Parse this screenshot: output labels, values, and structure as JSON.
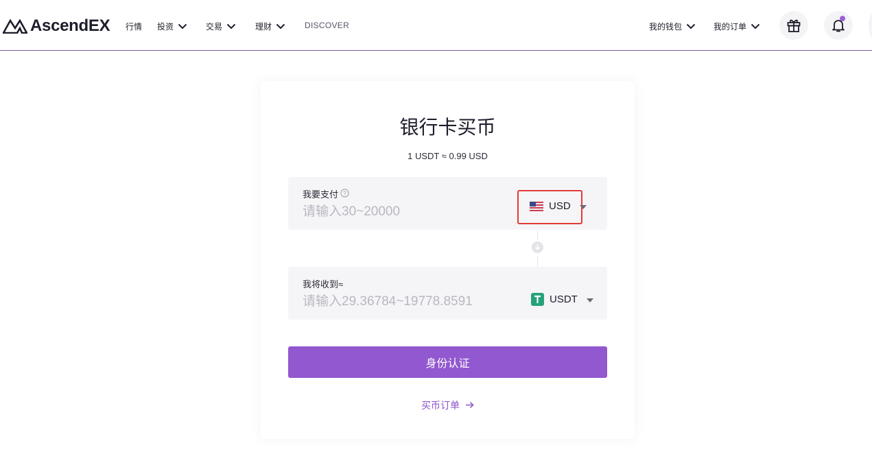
{
  "brand": {
    "name": "AscendEX"
  },
  "nav": {
    "items": [
      {
        "label": "行情",
        "dropdown": false
      },
      {
        "label": "投资",
        "dropdown": true
      },
      {
        "label": "交易",
        "dropdown": true
      },
      {
        "label": "理财",
        "dropdown": true
      },
      {
        "label": "DISCOVER",
        "dropdown": false
      }
    ],
    "right": [
      {
        "label": "我的钱包",
        "dropdown": true
      },
      {
        "label": "我的订单",
        "dropdown": true
      }
    ],
    "icons": [
      "gift-icon",
      "bell-icon"
    ]
  },
  "card": {
    "title": "银行卡买币",
    "rate": "1 USDT ≈ 0.99 USD",
    "pay": {
      "label": "我要支付",
      "placeholder": "请输入30~20000",
      "currency": "USD",
      "currency_icon": "us-flag-icon"
    },
    "receive": {
      "label": "我将收到≈",
      "placeholder": "请输入29.36784~19778.8591",
      "currency": "USDT",
      "currency_icon": "tether-icon",
      "currency_color": "#26a17b"
    },
    "submit_label": "身份认证",
    "orders_link": "买币订单"
  },
  "colors": {
    "accent": "#9258cf",
    "link": "#8a52c8",
    "highlight_border": "#e53935"
  }
}
